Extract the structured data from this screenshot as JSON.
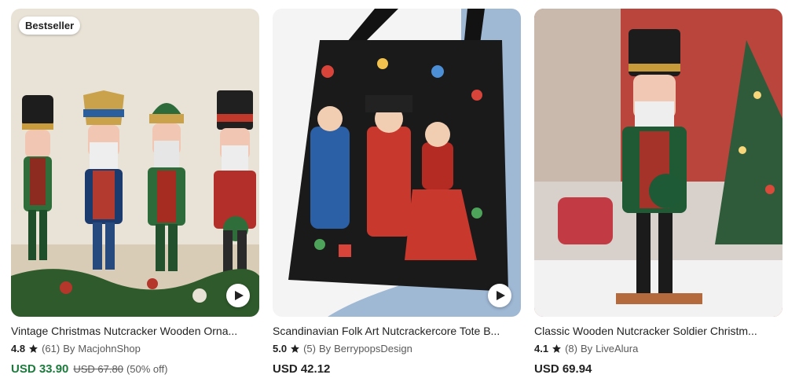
{
  "products": [
    {
      "badge": "Bestseller",
      "title": "Vintage Christmas Nutcracker Wooden Orna...",
      "rating": "4.8",
      "reviews": "(61)",
      "by": "By",
      "shop": "MacjohnShop",
      "price": "USD 33.90",
      "original_price": "USD 67.80",
      "discount": "(50% off)",
      "has_video": true,
      "image_icon": "nutcracker-row-photo"
    },
    {
      "title": "Scandinavian Folk Art Nutcrackercore Tote B...",
      "rating": "5.0",
      "reviews": "(5)",
      "by": "By",
      "shop": "BerrypopsDesign",
      "price": "USD 42.12",
      "has_video": true,
      "image_icon": "tote-bag-photo"
    },
    {
      "title": "Classic Wooden Nutcracker Soldier Christm...",
      "rating": "4.1",
      "reviews": "(8)",
      "by": "By",
      "shop": "LiveAlura",
      "price": "USD 69.94",
      "has_video": false,
      "image_icon": "nutcracker-soldier-photo"
    }
  ],
  "colors": {
    "sale_price": "#1c7a3c",
    "text": "#222222",
    "muted": "#595959"
  }
}
